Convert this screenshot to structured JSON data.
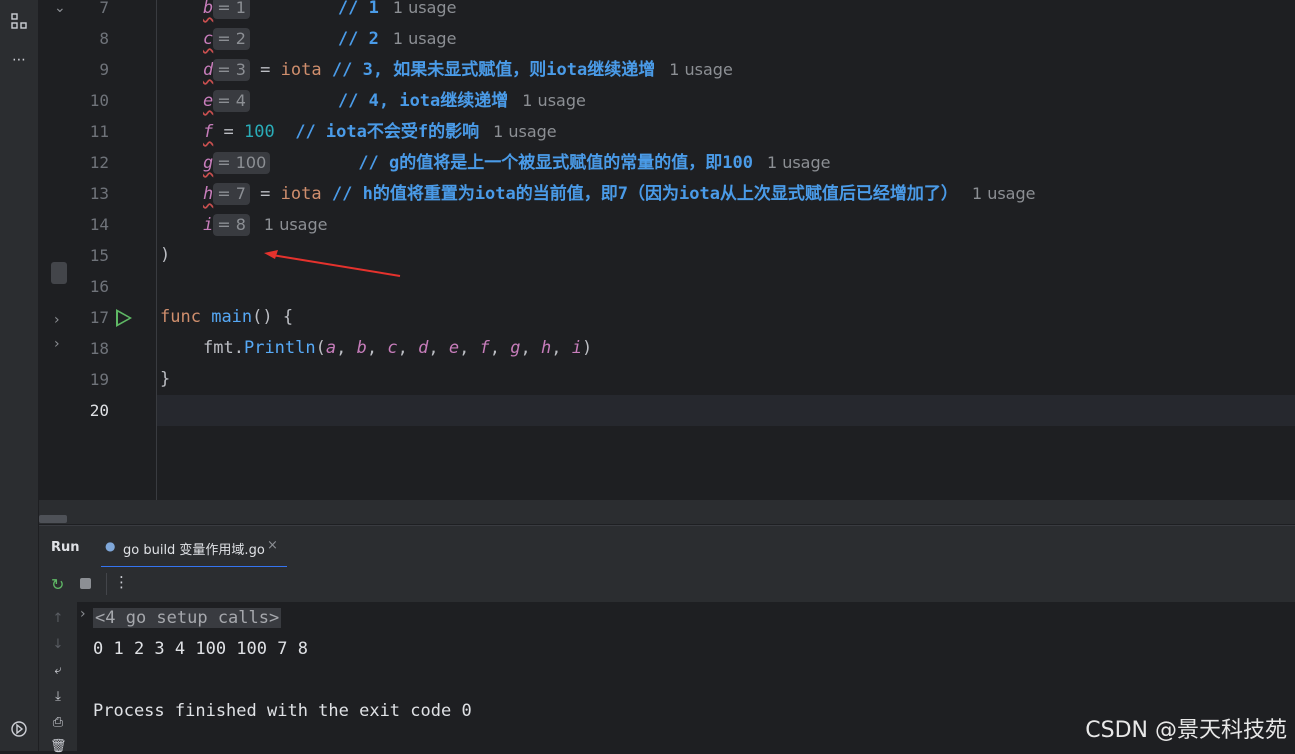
{
  "editor": {
    "lines": [
      {
        "num": "7",
        "id": "b",
        "hint": "= 1",
        "comment": "// 1",
        "usage": "1 usage"
      },
      {
        "num": "8",
        "id": "c",
        "hint": "= 2",
        "comment": "// 2",
        "usage": "1 usage"
      },
      {
        "num": "9",
        "id": "d",
        "hint": "= 3",
        "op": "=",
        "kw": "iota",
        "comment": "// 3, 如果未显式赋值，则iota继续递增",
        "usage": "1 usage"
      },
      {
        "num": "10",
        "id": "e",
        "hint": "= 4",
        "comment": "// 4, iota继续递增",
        "usage": "1 usage"
      },
      {
        "num": "11",
        "id": "f",
        "op": "=",
        "val": "100",
        "comment": "// iota不会受f的影响",
        "usage": "1 usage"
      },
      {
        "num": "12",
        "id": "g",
        "hint": "= 100",
        "comment": "// g的值将是上一个被显式赋值的常量的值，即100",
        "usage": "1 usage"
      },
      {
        "num": "13",
        "id": "h",
        "hint": "= 7",
        "op": "=",
        "kw": "iota",
        "comment": "// h的值将重置为iota的当前值，即7（因为iota从上次显式赋值后已经增加了）",
        "usage": "1 usage"
      },
      {
        "num": "14",
        "id": "i",
        "hint": "= 8",
        "usage": "1 usage"
      },
      {
        "num": "15",
        "text": ")"
      },
      {
        "num": "16",
        "text": ""
      },
      {
        "num": "17",
        "func_kw": "func",
        "func_name": "main",
        "func_rest": "() {"
      },
      {
        "num": "18",
        "pkg": "fmt",
        "call": "Println",
        "args": [
          "a",
          "b",
          "c",
          "d",
          "e",
          "f",
          "g",
          "h",
          "i"
        ]
      },
      {
        "num": "19",
        "text": "}"
      },
      {
        "num": "20",
        "text": ""
      }
    ]
  },
  "run_panel": {
    "title": "Run",
    "tab_label": "go build 变量作用域.go",
    "close_glyph": "×",
    "console": {
      "setup_calls": "<4 go setup calls>",
      "output": "0 1 2 3 4 100 100 7 8",
      "finished": "Process finished with the exit code 0"
    }
  },
  "watermark": "CSDN @景天科技苑",
  "colors": {
    "accent_run": "#5fb865",
    "arrow": "#e5322d",
    "keyword": "#cf8e6d",
    "comment": "#4a9be8",
    "number": "#2aacb8"
  }
}
